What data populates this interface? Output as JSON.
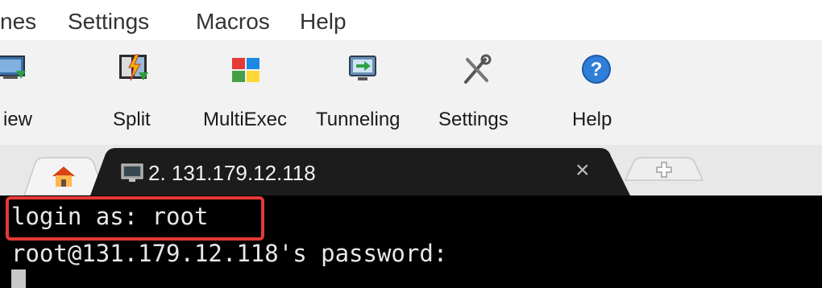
{
  "menu": {
    "items": [
      "nes",
      "Settings",
      "Macros",
      "Help"
    ]
  },
  "toolbar": {
    "buttons": [
      {
        "label": "iew",
        "icon": "view-icon"
      },
      {
        "label": "Split",
        "icon": "split-icon"
      },
      {
        "label": "MultiExec",
        "icon": "multiexec-icon"
      },
      {
        "label": "Tunneling",
        "icon": "tunneling-icon"
      },
      {
        "label": "Settings",
        "icon": "settings-icon"
      },
      {
        "label": "Help",
        "icon": "help-icon"
      }
    ]
  },
  "tabs": {
    "home_icon": "home-icon",
    "active_tab": {
      "label": "2. 131.179.12.118",
      "icon": "terminal-icon",
      "close": "×"
    },
    "new_tab_icon": "plus-icon"
  },
  "terminal": {
    "lines": [
      "login as: root",
      "root@131.179.12.118's password:"
    ]
  },
  "colors": {
    "highlight": "#e53935",
    "terminal_bg": "#000000",
    "active_tab_bg": "#1c1c1c"
  }
}
